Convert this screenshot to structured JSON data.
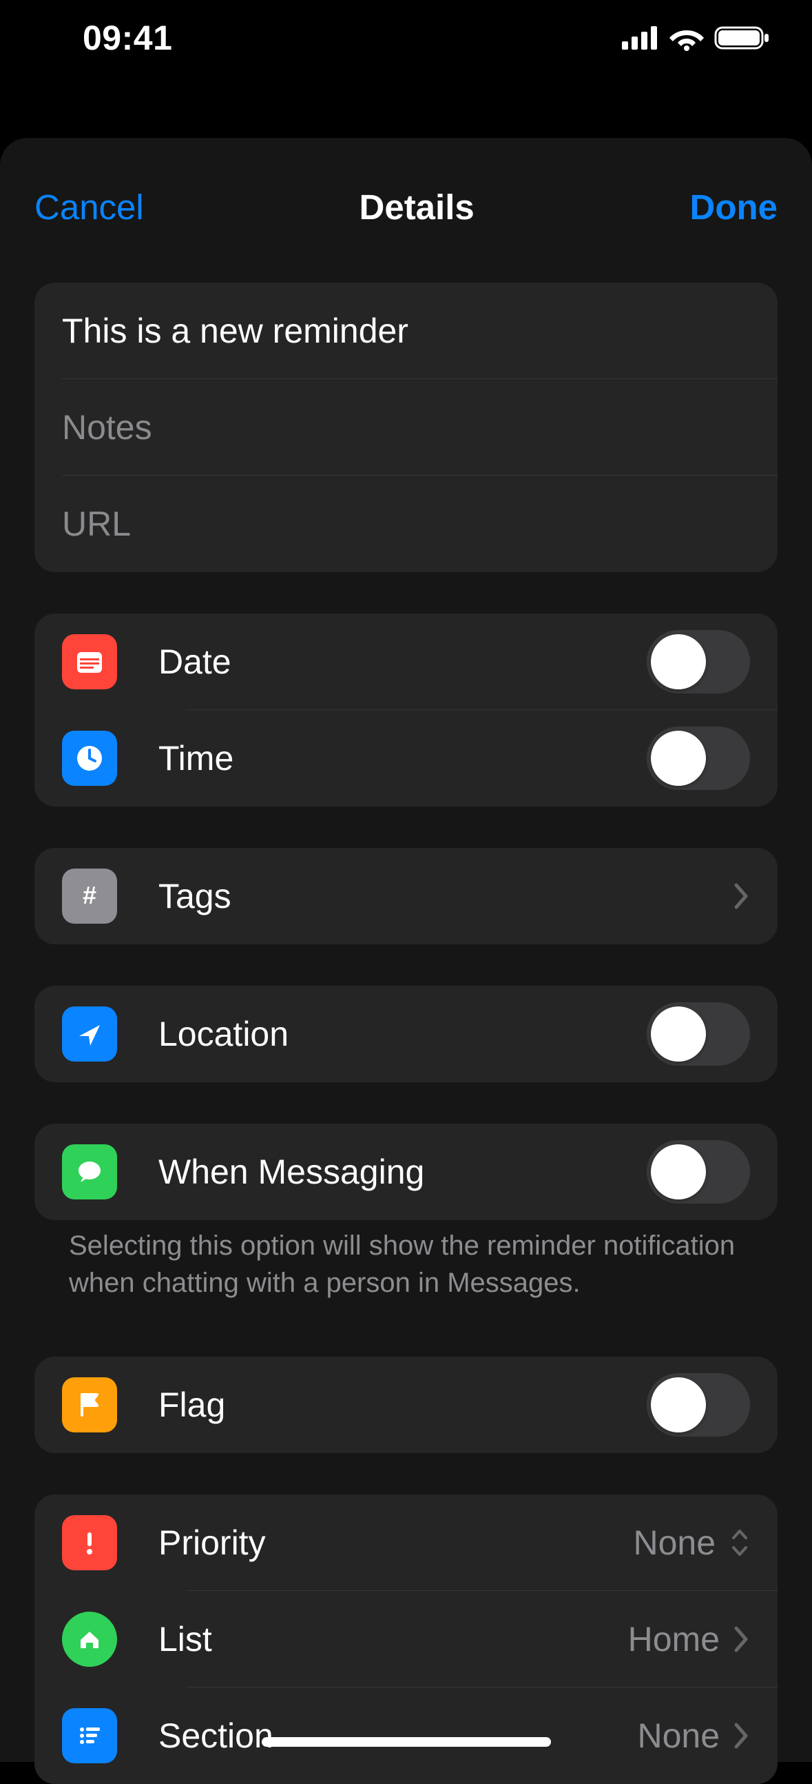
{
  "status": {
    "time": "09:41"
  },
  "nav": {
    "cancel": "Cancel",
    "title": "Details",
    "done": "Done"
  },
  "fields": {
    "title_value": "This is a new reminder",
    "notes_placeholder": "Notes",
    "url_placeholder": "URL"
  },
  "rows": {
    "date": "Date",
    "time": "Time",
    "tags": "Tags",
    "location": "Location",
    "messaging": "When Messaging",
    "flag": "Flag",
    "priority": "Priority",
    "list": "List",
    "section": "Section"
  },
  "values": {
    "priority": "None",
    "list": "Home",
    "section": "None"
  },
  "footnote": "Selecting this option will show the reminder notification when chatting with a person in Messages.",
  "colors": {
    "date": "#ff453a",
    "time": "#0a84ff",
    "tags": "#8e8e93",
    "location": "#0a84ff",
    "messaging": "#30d158",
    "flag": "#ff9f0a",
    "priority": "#ff453a",
    "list": "#30d158",
    "section": "#0a84ff"
  }
}
